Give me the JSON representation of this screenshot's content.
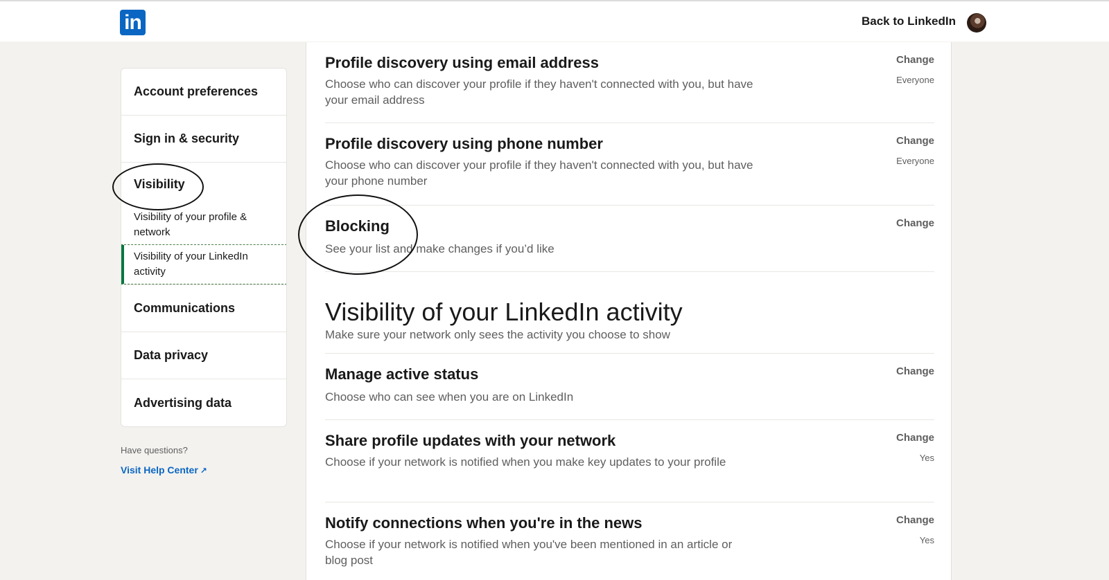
{
  "header": {
    "logo_text": "in",
    "back_link": "Back to LinkedIn"
  },
  "sidebar": {
    "items": [
      {
        "label": "Account preferences"
      },
      {
        "label": "Sign in & security"
      },
      {
        "label": "Visibility"
      }
    ],
    "sub_items": [
      {
        "label": "Visibility of your profile & network"
      },
      {
        "label": "Visibility of your LinkedIn activity"
      }
    ],
    "items_after": [
      {
        "label": "Communications"
      },
      {
        "label": "Data privacy"
      },
      {
        "label": "Advertising data"
      }
    ],
    "questions": "Have questions?",
    "help_link": "Visit Help Center"
  },
  "main": {
    "rows_top": [
      {
        "title": "Profile discovery using email address",
        "desc": "Choose who can discover your profile if they haven't connected with you, but have your email address",
        "change": "Change",
        "value": "Everyone"
      },
      {
        "title": "Profile discovery using phone number",
        "desc": "Choose who can discover your profile if they haven't connected with you, but have your phone number",
        "change": "Change",
        "value": "Everyone"
      },
      {
        "title": "Blocking",
        "desc": "See your list and make changes if you’d like",
        "change": "Change",
        "value": ""
      }
    ],
    "section": {
      "title": "Visibility of your LinkedIn activity",
      "subtitle": "Make sure your network only sees the activity you choose to show"
    },
    "rows_bottom": [
      {
        "title": "Manage active status",
        "desc": "Choose who can see when you are on LinkedIn",
        "change": "Change",
        "value": ""
      },
      {
        "title": "Share profile updates with your network",
        "desc": "Choose if your network is notified when you make key updates to your profile",
        "change": "Change",
        "value": "Yes"
      },
      {
        "title": "Notify connections when you're in the news",
        "desc": "Choose if your network is notified when you've been mentioned in an article or blog post",
        "change": "Change",
        "value": "Yes"
      }
    ]
  }
}
